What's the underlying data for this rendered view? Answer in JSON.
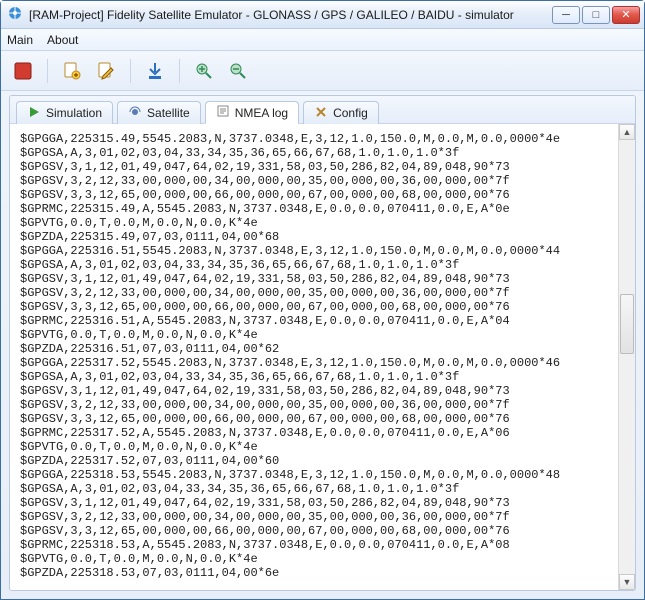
{
  "window": {
    "title": "[RAM-Project] Fidelity Satellite Emulator - GLONASS / GPS / GALILEO / BAIDU - simulator"
  },
  "menu": {
    "main": "Main",
    "about": "About"
  },
  "tabs": {
    "simulation": "Simulation",
    "satellite": "Satellite",
    "nmea": "NMEA log",
    "config": "Config",
    "active": "nmea"
  },
  "log_lines": [
    "$GPGGA,225315.49,5545.2083,N,3737.0348,E,3,12,1.0,150.0,M,0.0,M,0.0,0000*4e",
    "$GPGSA,A,3,01,02,03,04,33,34,35,36,65,66,67,68,1.0,1.0,1.0*3f",
    "$GPGSV,3,1,12,01,49,047,64,02,19,331,58,03,50,286,82,04,89,048,90*73",
    "$GPGSV,3,2,12,33,00,000,00,34,00,000,00,35,00,000,00,36,00,000,00*7f",
    "$GPGSV,3,3,12,65,00,000,00,66,00,000,00,67,00,000,00,68,00,000,00*76",
    "$GPRMC,225315.49,A,5545.2083,N,3737.0348,E,0.0,0.0,070411,0.0,E,A*0e",
    "$GPVTG,0.0,T,0.0,M,0.0,N,0.0,K*4e",
    "$GPZDA,225315.49,07,03,0111,04,00*68",
    "$GPGGA,225316.51,5545.2083,N,3737.0348,E,3,12,1.0,150.0,M,0.0,M,0.0,0000*44",
    "$GPGSA,A,3,01,02,03,04,33,34,35,36,65,66,67,68,1.0,1.0,1.0*3f",
    "$GPGSV,3,1,12,01,49,047,64,02,19,331,58,03,50,286,82,04,89,048,90*73",
    "$GPGSV,3,2,12,33,00,000,00,34,00,000,00,35,00,000,00,36,00,000,00*7f",
    "$GPGSV,3,3,12,65,00,000,00,66,00,000,00,67,00,000,00,68,00,000,00*76",
    "$GPRMC,225316.51,A,5545.2083,N,3737.0348,E,0.0,0.0,070411,0.0,E,A*04",
    "$GPVTG,0.0,T,0.0,M,0.0,N,0.0,K*4e",
    "$GPZDA,225316.51,07,03,0111,04,00*62",
    "$GPGGA,225317.52,5545.2083,N,3737.0348,E,3,12,1.0,150.0,M,0.0,M,0.0,0000*46",
    "$GPGSA,A,3,01,02,03,04,33,34,35,36,65,66,67,68,1.0,1.0,1.0*3f",
    "$GPGSV,3,1,12,01,49,047,64,02,19,331,58,03,50,286,82,04,89,048,90*73",
    "$GPGSV,3,2,12,33,00,000,00,34,00,000,00,35,00,000,00,36,00,000,00*7f",
    "$GPGSV,3,3,12,65,00,000,00,66,00,000,00,67,00,000,00,68,00,000,00*76",
    "$GPRMC,225317.52,A,5545.2083,N,3737.0348,E,0.0,0.0,070411,0.0,E,A*06",
    "$GPVTG,0.0,T,0.0,M,0.0,N,0.0,K*4e",
    "$GPZDA,225317.52,07,03,0111,04,00*60",
    "$GPGGA,225318.53,5545.2083,N,3737.0348,E,3,12,1.0,150.0,M,0.0,M,0.0,0000*48",
    "$GPGSA,A,3,01,02,03,04,33,34,35,36,65,66,67,68,1.0,1.0,1.0*3f",
    "$GPGSV,3,1,12,01,49,047,64,02,19,331,58,03,50,286,82,04,89,048,90*73",
    "$GPGSV,3,2,12,33,00,000,00,34,00,000,00,35,00,000,00,36,00,000,00*7f",
    "$GPGSV,3,3,12,65,00,000,00,66,00,000,00,67,00,000,00,68,00,000,00*76",
    "$GPRMC,225318.53,A,5545.2083,N,3737.0348,E,0.0,0.0,070411,0.0,E,A*08",
    "$GPVTG,0.0,T,0.0,M,0.0,N,0.0,K*4e",
    "$GPZDA,225318.53,07,03,0111,04,00*6e"
  ]
}
